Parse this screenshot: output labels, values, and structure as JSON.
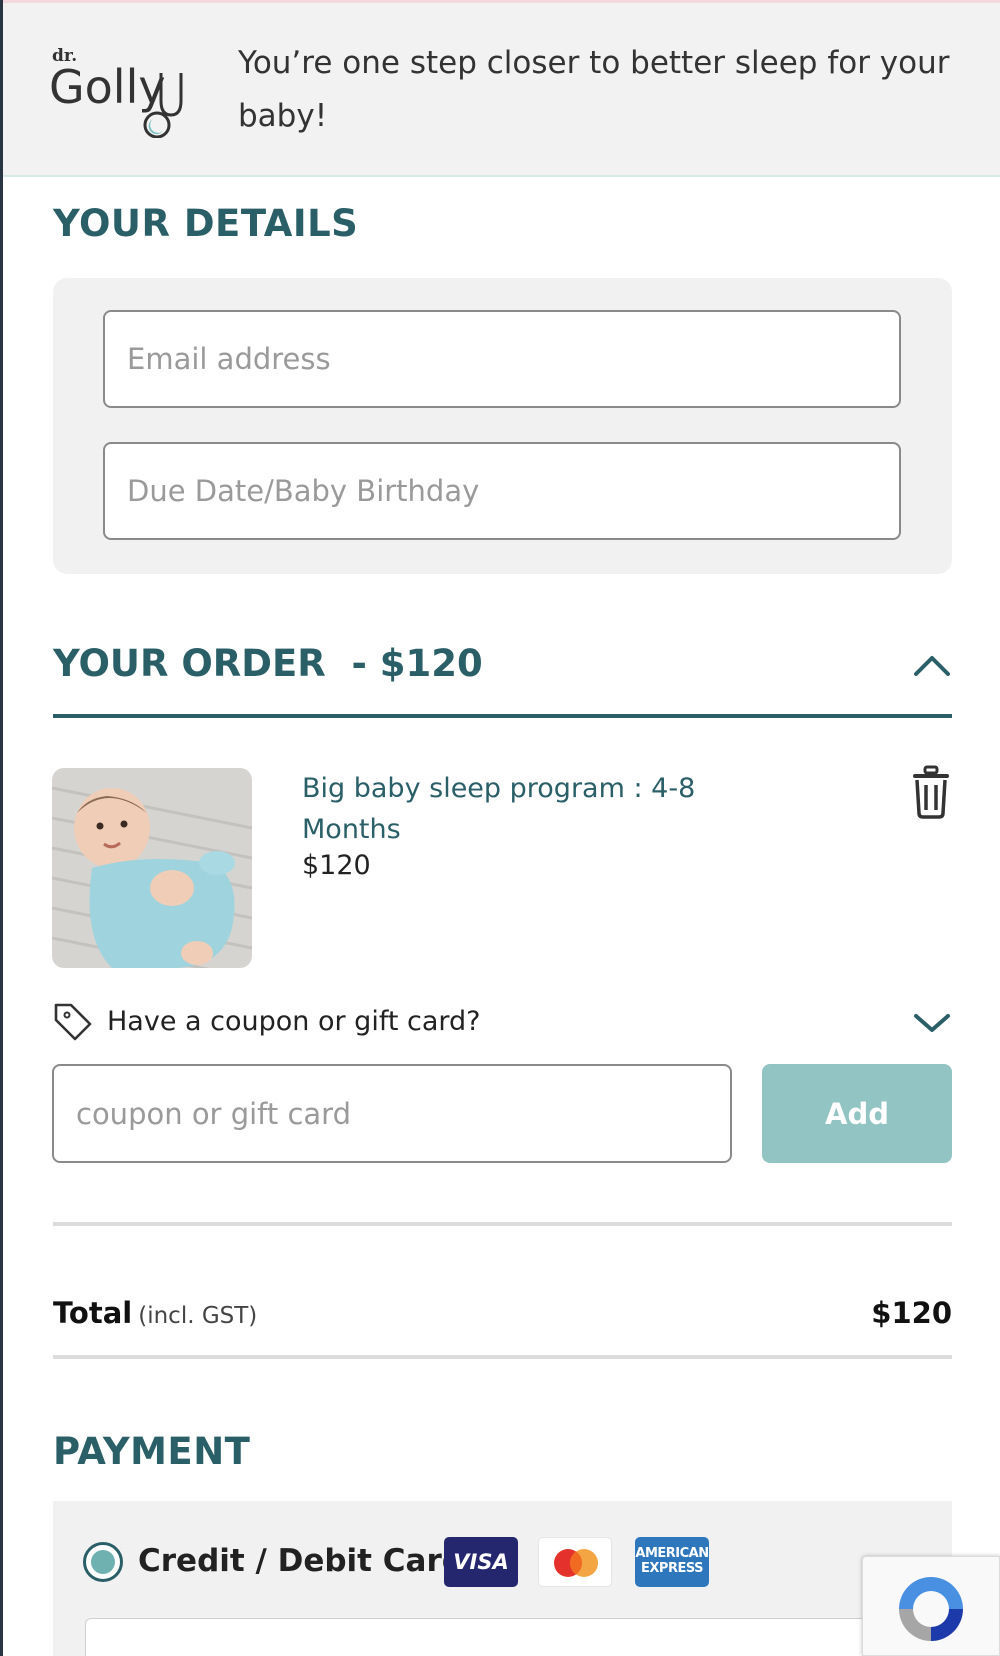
{
  "header": {
    "logo_text_small": "dr.",
    "logo_text": "Golly",
    "tagline": "You’re one step closer to better sleep for your baby!"
  },
  "details": {
    "title": "YOUR DETAILS",
    "email_placeholder": "Email address",
    "due_date_placeholder": "Due Date/Baby Birthday"
  },
  "order": {
    "title": "YOUR ORDER  - $120",
    "product": {
      "name": "Big baby sleep program : 4-8 Months",
      "price": "$120"
    },
    "coupon_toggle_label": "Have a coupon or gift card?",
    "coupon_placeholder": "coupon or gift card",
    "add_button_label": "Add",
    "total_label": "Total",
    "total_note": "(incl. GST)",
    "total_value": "$120"
  },
  "payment": {
    "title": "PAYMENT",
    "method_label": "Credit / Debit Card",
    "selected": true,
    "card_brands": {
      "visa": "VISA",
      "amex_line1": "AMERICAN",
      "amex_line2": "EXPRESS"
    }
  },
  "colors": {
    "accent": "#2a5f68",
    "add_button": "#93c4c4",
    "radio_dot": "#6fb0b0"
  }
}
